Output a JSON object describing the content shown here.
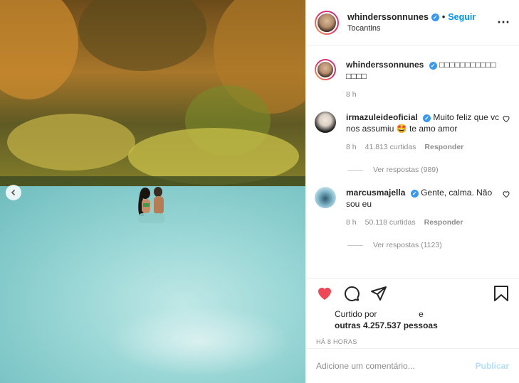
{
  "post": {
    "username": "whinderssonnunes",
    "follow_dot": "•",
    "follow_label": "Seguir",
    "location": "Tocantins",
    "more_icon": "⋯"
  },
  "caption": {
    "username": "whinderssonnunes",
    "text": "□□□□□□□□□□□ □□□□",
    "time": "8 h"
  },
  "comments": [
    {
      "username": "irmazuleideoficial",
      "text": "Muito feliz que vc nos assumiu 🤩 te amo amor",
      "time": "8 h",
      "likes": "41.813 curtidas",
      "reply_label": "Responder",
      "view_replies": "Ver respostas (989)"
    },
    {
      "username": "marcusmajella",
      "text": "Gente, calma. Não sou eu",
      "time": "8 h",
      "likes": "50.118 curtidas",
      "reply_label": "Responder",
      "view_replies": "Ver respostas (1123)"
    }
  ],
  "likes": {
    "liked_by_prefix": "Curtido por",
    "and": "e",
    "others": "outras 4.257.537 pessoas"
  },
  "timestamp": "HÁ 8 HORAS",
  "add_comment": {
    "placeholder": "Adicione um comentário...",
    "publish_label": "Publicar"
  },
  "colors": {
    "accent": "#0095f6",
    "like_red": "#ed4956",
    "verified": "#3897f0",
    "muted": "#8e8e8e",
    "publish_disabled": "#b2dffc"
  }
}
